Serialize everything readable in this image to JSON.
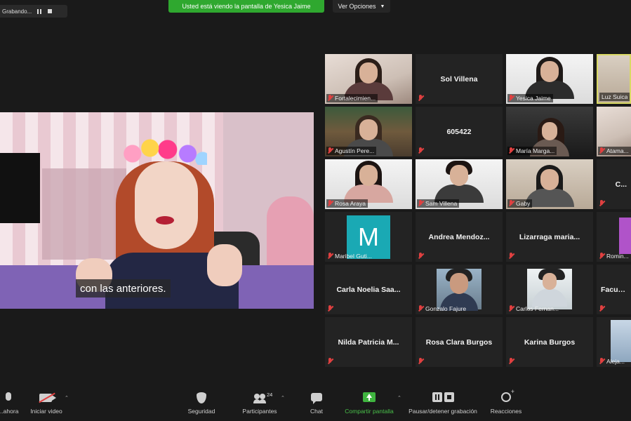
{
  "top_bar": {
    "recording_label": "Grabando...",
    "share_banner": "Usted está viendo la pantalla de Yesica Jaime",
    "view_options": "Ver Opciones"
  },
  "main_video": {
    "caption": "con las anteriores."
  },
  "gallery": {
    "tiles": [
      {
        "label": "Fortalecimien..."
      },
      {
        "name": "Sol Villena"
      },
      {
        "label": "Yesica Jaime"
      },
      {
        "label": "Luz Suica"
      },
      {
        "label": "Agustín Pere..."
      },
      {
        "name": "605422"
      },
      {
        "label": "María Marga..."
      },
      {
        "label": "Atama..."
      },
      {
        "label": "Rosa Araya"
      },
      {
        "label": "Sam Villena"
      },
      {
        "label": "Gaby"
      },
      {
        "label": "C..."
      },
      {
        "avatar_letter": "M",
        "label": "Maribel Guti..."
      },
      {
        "name": "Andrea Mendoz..."
      },
      {
        "name": "Lizarraga maria..."
      },
      {
        "label": "Romin..."
      },
      {
        "name": "Carla Noelia Saa..."
      },
      {
        "label": "Gonzalo Fajure"
      },
      {
        "label": "Carlos Fernan..."
      },
      {
        "label": "Facun..."
      },
      {
        "name": "Nilda Patricia M..."
      },
      {
        "name": "Rosa Clara Burgos"
      },
      {
        "name": "Karina Burgos"
      },
      {
        "label": "Aleja..."
      }
    ]
  },
  "toolbar": {
    "mute_label": "...ahora",
    "video_label": "Iniciar video",
    "security_label": "Seguridad",
    "participants_label": "Participantes",
    "participants_count": "24",
    "chat_label": "Chat",
    "share_label": "Compartir pantalla",
    "recording_label": "Pausar/detener grabación",
    "reactions_label": "Reacciones"
  },
  "colors": {
    "background": "#1a1a1a",
    "share_green": "#2fa82f",
    "muted_red": "#e04040",
    "active_speaker": "#d9d964",
    "avatar_teal": "#1aa9b4"
  }
}
